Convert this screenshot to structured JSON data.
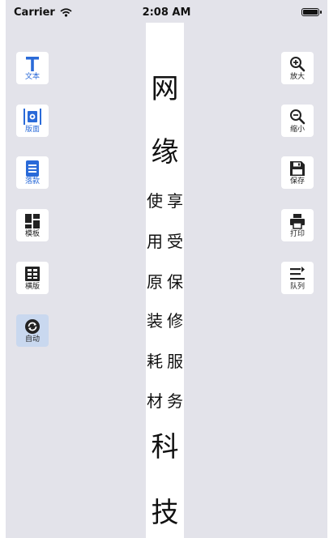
{
  "status_bar": {
    "carrier": "Carrier",
    "time": "2:08 AM"
  },
  "left_tools": [
    {
      "label": "文本",
      "icon": "text-icon"
    },
    {
      "label": "版面",
      "icon": "layout-gear-icon"
    },
    {
      "label": "落款",
      "icon": "signature-doc-icon"
    },
    {
      "label": "模板",
      "icon": "template-grid-icon"
    },
    {
      "label": "横版",
      "icon": "horizontal-layout-icon"
    },
    {
      "label": "自动",
      "icon": "auto-refresh-icon"
    }
  ],
  "right_tools": [
    {
      "label": "放大",
      "icon": "zoom-in-icon"
    },
    {
      "label": "缩小",
      "icon": "zoom-out-icon"
    },
    {
      "label": "保存",
      "icon": "save-icon"
    },
    {
      "label": "打印",
      "icon": "print-icon"
    },
    {
      "label": "队列",
      "icon": "queue-icon"
    }
  ],
  "canvas": {
    "title_chars": [
      "网",
      "缘"
    ],
    "body_pairs": [
      [
        "使",
        "享"
      ],
      [
        "用",
        "受"
      ],
      [
        "原",
        "保"
      ],
      [
        "装",
        "修"
      ],
      [
        "耗",
        "服"
      ],
      [
        "材",
        "务"
      ]
    ],
    "footer_chars": [
      "科",
      "技"
    ]
  },
  "colors": {
    "accent": "#2a6ad8",
    "background": "#e3e3ea",
    "auto_highlight": "#c9d8ef"
  }
}
